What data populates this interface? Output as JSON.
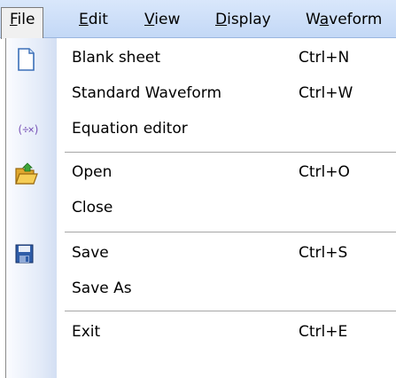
{
  "menubar": {
    "items": [
      {
        "pre": "",
        "u": "F",
        "post": "ile"
      },
      {
        "pre": "",
        "u": "E",
        "post": "dit"
      },
      {
        "pre": "",
        "u": "V",
        "post": "iew"
      },
      {
        "pre": "",
        "u": "D",
        "post": "isplay"
      },
      {
        "pre": "W",
        "u": "a",
        "post": "veform"
      }
    ]
  },
  "file_menu": {
    "items": [
      {
        "label": "Blank sheet",
        "shortcut": "Ctrl+N",
        "icon": "blank-sheet-icon"
      },
      {
        "label": "Standard Waveform",
        "shortcut": "Ctrl+W",
        "icon": ""
      },
      {
        "label": "Equation editor",
        "shortcut": "",
        "icon": "equation-editor-icon",
        "glyph": "(÷×)"
      },
      {
        "label": "Open",
        "shortcut": "Ctrl+O",
        "icon": "open-folder-icon"
      },
      {
        "label": "Close",
        "shortcut": "",
        "icon": ""
      },
      {
        "label": "Save",
        "shortcut": "Ctrl+S",
        "icon": "floppy-disk-icon"
      },
      {
        "label": "Save As",
        "shortcut": "",
        "icon": ""
      },
      {
        "label": "Exit",
        "shortcut": "Ctrl+E",
        "icon": ""
      }
    ]
  },
  "colors": {
    "menubar_bg": "#c9dcf7",
    "icon_strip": "#dde6f5",
    "separator": "#a6a6a6"
  }
}
